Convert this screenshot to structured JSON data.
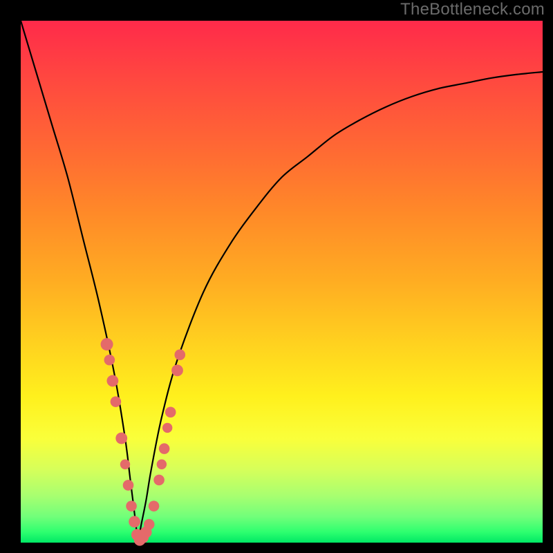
{
  "watermark": "TheBottleneck.com",
  "chart_data": {
    "type": "line",
    "title": "",
    "xlabel": "",
    "ylabel": "",
    "xlim": [
      0,
      100
    ],
    "ylim": [
      0,
      100
    ],
    "grid": false,
    "legend": false,
    "comment": "Bottleneck-percentage curve. The x-axis is an implicit hardware-balance parameter (0–100); the y-axis is bottleneck percentage (0 at bottom → no bottleneck / green, 100 at top → full bottleneck / red). The curve forms a V with its minimum near x≈22.5. Pink markers are sampled configurations clustered around the minimum.",
    "series": [
      {
        "name": "bottleneck-curve",
        "x": [
          0,
          3,
          6,
          9,
          12,
          15,
          18,
          20,
          21,
          22,
          22.5,
          23,
          24,
          25,
          27,
          30,
          35,
          40,
          45,
          50,
          55,
          60,
          65,
          70,
          75,
          80,
          85,
          90,
          95,
          100
        ],
        "values": [
          100,
          90,
          80,
          70,
          58,
          46,
          32,
          20,
          12,
          4,
          0,
          3,
          8,
          14,
          24,
          35,
          48,
          57,
          64,
          70,
          74,
          78,
          81,
          83.5,
          85.5,
          87,
          88,
          89,
          89.7,
          90.2
        ]
      }
    ],
    "markers": {
      "name": "sampled-points",
      "points": [
        {
          "x": 16.5,
          "y": 38,
          "r": 1.5
        },
        {
          "x": 17.0,
          "y": 35,
          "r": 1.3
        },
        {
          "x": 17.6,
          "y": 31,
          "r": 1.4
        },
        {
          "x": 18.2,
          "y": 27,
          "r": 1.3
        },
        {
          "x": 19.3,
          "y": 20,
          "r": 1.4
        },
        {
          "x": 20.0,
          "y": 15,
          "r": 1.2
        },
        {
          "x": 20.6,
          "y": 11,
          "r": 1.3
        },
        {
          "x": 21.2,
          "y": 7,
          "r": 1.3
        },
        {
          "x": 21.8,
          "y": 4,
          "r": 1.4
        },
        {
          "x": 22.3,
          "y": 1.5,
          "r": 1.4
        },
        {
          "x": 22.8,
          "y": 0.5,
          "r": 1.4
        },
        {
          "x": 23.4,
          "y": 1,
          "r": 1.4
        },
        {
          "x": 24.0,
          "y": 2,
          "r": 1.4
        },
        {
          "x": 24.6,
          "y": 3.5,
          "r": 1.3
        },
        {
          "x": 25.5,
          "y": 7,
          "r": 1.3
        },
        {
          "x": 26.5,
          "y": 12,
          "r": 1.3
        },
        {
          "x": 27.0,
          "y": 15,
          "r": 1.2
        },
        {
          "x": 27.5,
          "y": 18,
          "r": 1.3
        },
        {
          "x": 28.1,
          "y": 22,
          "r": 1.2
        },
        {
          "x": 28.7,
          "y": 25,
          "r": 1.3
        },
        {
          "x": 30.0,
          "y": 33,
          "r": 1.4
        },
        {
          "x": 30.5,
          "y": 36,
          "r": 1.3
        }
      ]
    }
  }
}
